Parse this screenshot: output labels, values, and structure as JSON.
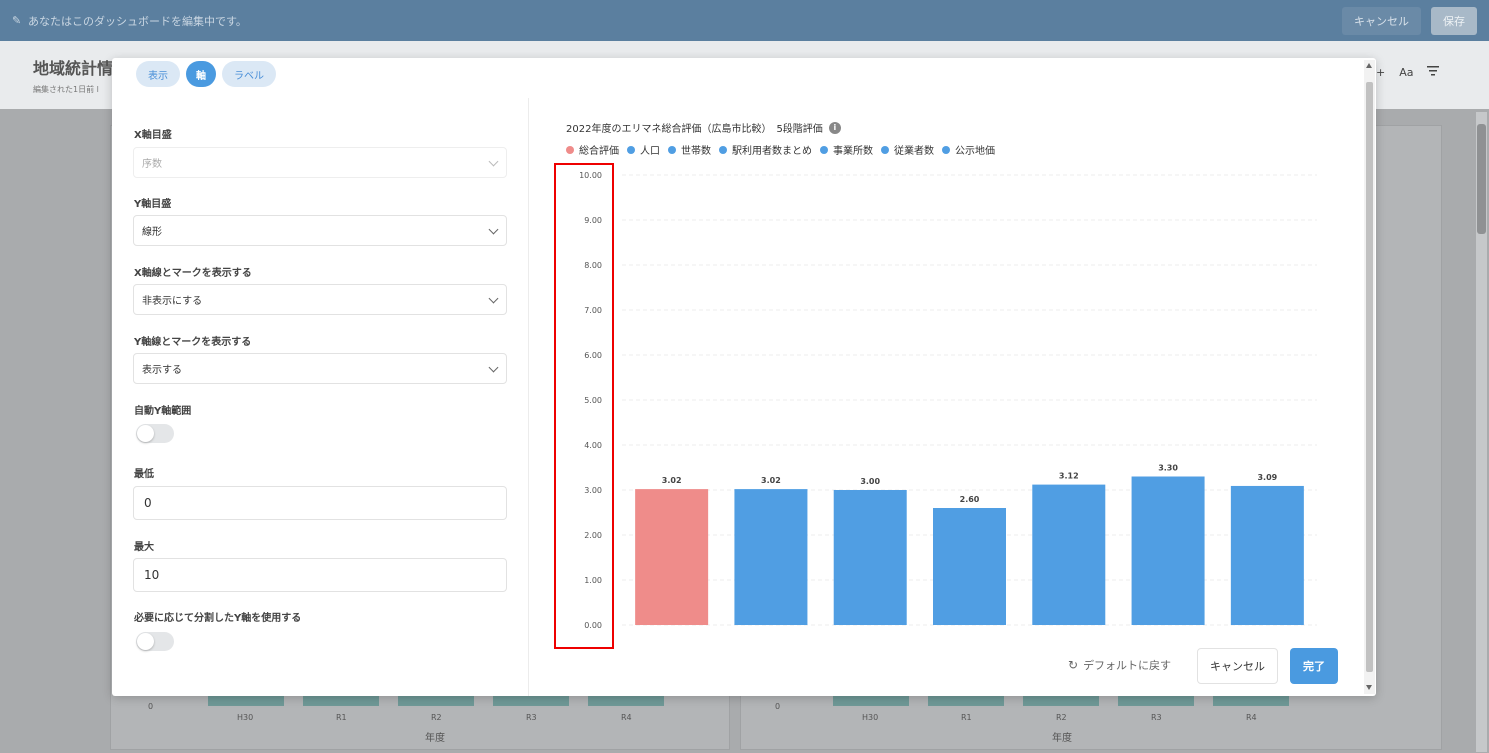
{
  "topbar": {
    "message": "あなたはこのダッシュボードを編集中です。",
    "cancel_label": "キャンセル",
    "save_label": "保存"
  },
  "dashboard": {
    "title": "地域統計情",
    "subtitle": "編集された1日前 l",
    "tools": [
      "+",
      "Aa",
      "filter-icon"
    ],
    "bg_axis_labels": [
      "H30",
      "R1",
      "R2",
      "R3",
      "R4"
    ],
    "bg_axis_title": "年度",
    "bg_zero": "0"
  },
  "modal": {
    "tabs": [
      {
        "label": "表示",
        "active": false
      },
      {
        "label": "軸",
        "active": true
      },
      {
        "label": "ラベル",
        "active": false
      }
    ],
    "fields": {
      "x_scale_label": "X軸目盛",
      "x_scale_value": "序数",
      "y_scale_label": "Y軸目盛",
      "y_scale_value": "線形",
      "x_axis_show_label": "X軸線とマークを表示する",
      "x_axis_show_value": "非表示にする",
      "y_axis_show_label": "Y軸線とマークを表示する",
      "y_axis_show_value": "表示する",
      "auto_y_label": "自動Y軸範囲",
      "auto_y_on": false,
      "min_label": "最低",
      "min_value": "0",
      "max_label": "最大",
      "max_value": "10",
      "split_y_label": "必要に応じて分割したY軸を使用する",
      "split_y_on": false
    },
    "reset_label": "デフォルトに戻す",
    "cancel_label": "キャンセル",
    "done_label": "完了"
  },
  "chart_data": {
    "type": "bar",
    "title": "2022年度のエリマネ総合評価（広島市比較）　5段階評価",
    "legend": [
      {
        "name": "総合評価",
        "color": "#ef8c8a"
      },
      {
        "name": "人口",
        "color": "#509ee3"
      },
      {
        "name": "世帯数",
        "color": "#509ee3"
      },
      {
        "name": "駅利用者数まとめ",
        "color": "#509ee3"
      },
      {
        "name": "事業所数",
        "color": "#509ee3"
      },
      {
        "name": "従業者数",
        "color": "#509ee3"
      },
      {
        "name": "公示地価",
        "color": "#509ee3"
      }
    ],
    "categories": [
      "総合評価",
      "人口",
      "世帯数",
      "駅利用者数まとめ",
      "事業所数",
      "従業者数",
      "公示地価"
    ],
    "values": [
      3.02,
      3.02,
      3.0,
      2.6,
      3.12,
      3.3,
      3.09
    ],
    "value_labels": [
      "3.02",
      "3.02",
      "3.00",
      "2.60",
      "3.12",
      "3.30",
      "3.09"
    ],
    "colors": [
      "#ef8c8a",
      "#509ee3",
      "#509ee3",
      "#509ee3",
      "#509ee3",
      "#509ee3",
      "#509ee3"
    ],
    "ylim": [
      0,
      10
    ],
    "y_ticks": [
      "0.00",
      "1.00",
      "2.00",
      "3.00",
      "4.00",
      "5.00",
      "6.00",
      "7.00",
      "8.00",
      "9.00",
      "10.00"
    ],
    "grid": true,
    "x_axis_visible": false
  }
}
